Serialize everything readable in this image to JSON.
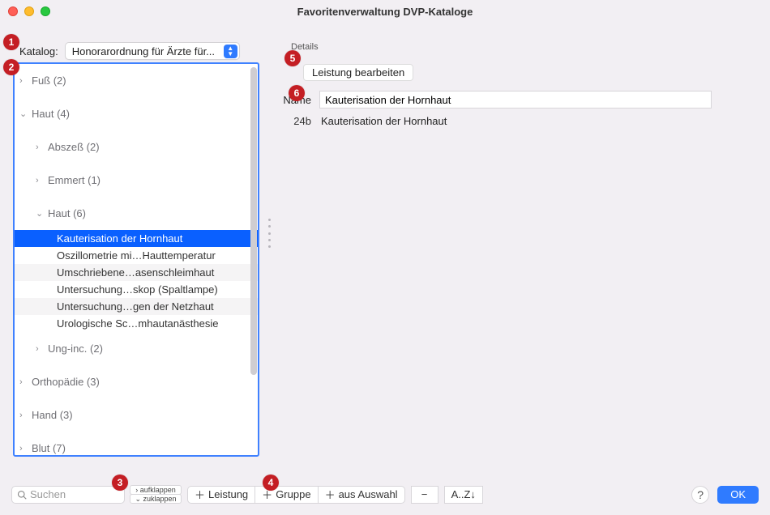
{
  "window": {
    "title": "Favoritenverwaltung DVP-Kataloge"
  },
  "katalog": {
    "label": "Katalog:",
    "selected": "Honorarordnung für Ärzte für..."
  },
  "details": {
    "section_label": "Details",
    "edit_label": "Leistung bearbeiten",
    "name_label": "Name",
    "name_value": "Kauterisation der Hornhaut",
    "code": "24b",
    "code_text": "Kauterisation der Hornhaut"
  },
  "tree": {
    "nodes": [
      {
        "label": "Fuß (2)",
        "state": "collapsed"
      },
      {
        "label": "Haut (4)",
        "state": "expanded",
        "children": [
          {
            "label": "Abszeß (2)",
            "state": "collapsed"
          },
          {
            "label": "Emmert (1)",
            "state": "collapsed"
          },
          {
            "label": "Haut (6)",
            "state": "expanded",
            "leaves": [
              {
                "label": "Kauterisation der Hornhaut",
                "selected": true
              },
              {
                "label": "Oszillometrie mi…Hauttemperatur"
              },
              {
                "label": "Umschriebene…asenschleimhaut"
              },
              {
                "label": "Untersuchung…skop (Spaltlampe)"
              },
              {
                "label": "Untersuchung…gen der Netzhaut"
              },
              {
                "label": "Urologische Sc…mhautanästhesie"
              }
            ]
          },
          {
            "label": "Ung-inc. (2)",
            "state": "collapsed"
          }
        ]
      },
      {
        "label": "Orthopädie (3)",
        "state": "collapsed"
      },
      {
        "label": "Hand (3)",
        "state": "collapsed"
      },
      {
        "label": "Blut (7)",
        "state": "collapsed"
      }
    ]
  },
  "toolbar": {
    "search_placeholder": "Suchen",
    "expand_label": "aufklappen",
    "collapse_label": "zuklappen",
    "add_leistung": "Leistung",
    "add_gruppe": "Gruppe",
    "add_auswahl": "aus Auswahl",
    "remove": "−",
    "sort": "A..Z↓",
    "help": "?",
    "ok": "OK"
  },
  "annotations": [
    "1",
    "2",
    "3",
    "4",
    "5",
    "6"
  ]
}
